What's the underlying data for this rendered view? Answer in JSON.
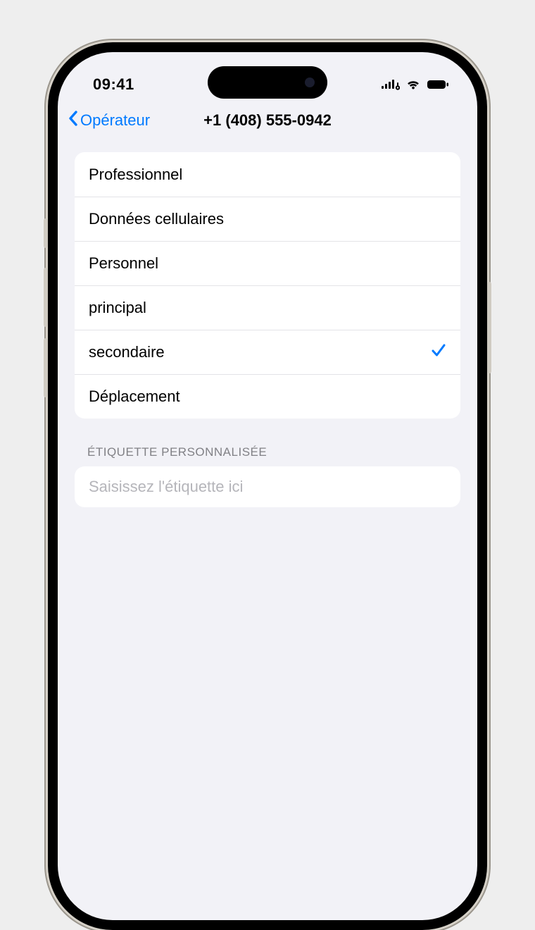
{
  "status": {
    "time": "09:41"
  },
  "nav": {
    "back_label": "Opérateur",
    "title": "+1 (408) 555-0942"
  },
  "labels": {
    "items": [
      {
        "label": "Professionnel",
        "selected": false
      },
      {
        "label": "Données cellulaires",
        "selected": false
      },
      {
        "label": "Personnel",
        "selected": false
      },
      {
        "label": "principal",
        "selected": false
      },
      {
        "label": "secondaire",
        "selected": true
      },
      {
        "label": "Déplacement",
        "selected": false
      }
    ]
  },
  "custom_label": {
    "header": "Étiquette personnalisée",
    "placeholder": "Saisissez l'étiquette ici",
    "value": ""
  },
  "colors": {
    "accent": "#007aff",
    "bg": "#f2f2f7"
  }
}
